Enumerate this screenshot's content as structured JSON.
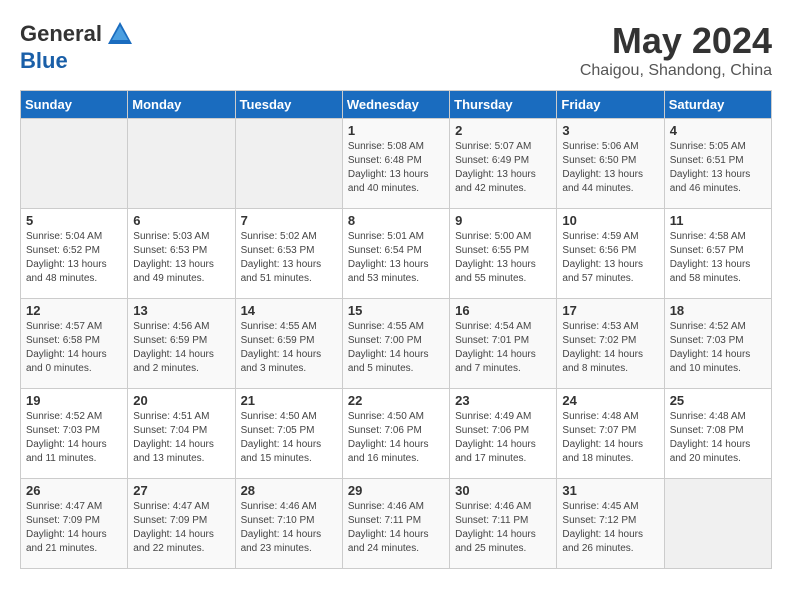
{
  "header": {
    "logo_general": "General",
    "logo_blue": "Blue",
    "month": "May 2024",
    "location": "Chaigou, Shandong, China"
  },
  "days_of_week": [
    "Sunday",
    "Monday",
    "Tuesday",
    "Wednesday",
    "Thursday",
    "Friday",
    "Saturday"
  ],
  "weeks": [
    [
      {
        "day": "",
        "info": ""
      },
      {
        "day": "",
        "info": ""
      },
      {
        "day": "",
        "info": ""
      },
      {
        "day": "1",
        "info": "Sunrise: 5:08 AM\nSunset: 6:48 PM\nDaylight: 13 hours\nand 40 minutes."
      },
      {
        "day": "2",
        "info": "Sunrise: 5:07 AM\nSunset: 6:49 PM\nDaylight: 13 hours\nand 42 minutes."
      },
      {
        "day": "3",
        "info": "Sunrise: 5:06 AM\nSunset: 6:50 PM\nDaylight: 13 hours\nand 44 minutes."
      },
      {
        "day": "4",
        "info": "Sunrise: 5:05 AM\nSunset: 6:51 PM\nDaylight: 13 hours\nand 46 minutes."
      }
    ],
    [
      {
        "day": "5",
        "info": "Sunrise: 5:04 AM\nSunset: 6:52 PM\nDaylight: 13 hours\nand 48 minutes."
      },
      {
        "day": "6",
        "info": "Sunrise: 5:03 AM\nSunset: 6:53 PM\nDaylight: 13 hours\nand 49 minutes."
      },
      {
        "day": "7",
        "info": "Sunrise: 5:02 AM\nSunset: 6:53 PM\nDaylight: 13 hours\nand 51 minutes."
      },
      {
        "day": "8",
        "info": "Sunrise: 5:01 AM\nSunset: 6:54 PM\nDaylight: 13 hours\nand 53 minutes."
      },
      {
        "day": "9",
        "info": "Sunrise: 5:00 AM\nSunset: 6:55 PM\nDaylight: 13 hours\nand 55 minutes."
      },
      {
        "day": "10",
        "info": "Sunrise: 4:59 AM\nSunset: 6:56 PM\nDaylight: 13 hours\nand 57 minutes."
      },
      {
        "day": "11",
        "info": "Sunrise: 4:58 AM\nSunset: 6:57 PM\nDaylight: 13 hours\nand 58 minutes."
      }
    ],
    [
      {
        "day": "12",
        "info": "Sunrise: 4:57 AM\nSunset: 6:58 PM\nDaylight: 14 hours\nand 0 minutes."
      },
      {
        "day": "13",
        "info": "Sunrise: 4:56 AM\nSunset: 6:59 PM\nDaylight: 14 hours\nand 2 minutes."
      },
      {
        "day": "14",
        "info": "Sunrise: 4:55 AM\nSunset: 6:59 PM\nDaylight: 14 hours\nand 3 minutes."
      },
      {
        "day": "15",
        "info": "Sunrise: 4:55 AM\nSunset: 7:00 PM\nDaylight: 14 hours\nand 5 minutes."
      },
      {
        "day": "16",
        "info": "Sunrise: 4:54 AM\nSunset: 7:01 PM\nDaylight: 14 hours\nand 7 minutes."
      },
      {
        "day": "17",
        "info": "Sunrise: 4:53 AM\nSunset: 7:02 PM\nDaylight: 14 hours\nand 8 minutes."
      },
      {
        "day": "18",
        "info": "Sunrise: 4:52 AM\nSunset: 7:03 PM\nDaylight: 14 hours\nand 10 minutes."
      }
    ],
    [
      {
        "day": "19",
        "info": "Sunrise: 4:52 AM\nSunset: 7:03 PM\nDaylight: 14 hours\nand 11 minutes."
      },
      {
        "day": "20",
        "info": "Sunrise: 4:51 AM\nSunset: 7:04 PM\nDaylight: 14 hours\nand 13 minutes."
      },
      {
        "day": "21",
        "info": "Sunrise: 4:50 AM\nSunset: 7:05 PM\nDaylight: 14 hours\nand 15 minutes."
      },
      {
        "day": "22",
        "info": "Sunrise: 4:50 AM\nSunset: 7:06 PM\nDaylight: 14 hours\nand 16 minutes."
      },
      {
        "day": "23",
        "info": "Sunrise: 4:49 AM\nSunset: 7:06 PM\nDaylight: 14 hours\nand 17 minutes."
      },
      {
        "day": "24",
        "info": "Sunrise: 4:48 AM\nSunset: 7:07 PM\nDaylight: 14 hours\nand 18 minutes."
      },
      {
        "day": "25",
        "info": "Sunrise: 4:48 AM\nSunset: 7:08 PM\nDaylight: 14 hours\nand 20 minutes."
      }
    ],
    [
      {
        "day": "26",
        "info": "Sunrise: 4:47 AM\nSunset: 7:09 PM\nDaylight: 14 hours\nand 21 minutes."
      },
      {
        "day": "27",
        "info": "Sunrise: 4:47 AM\nSunset: 7:09 PM\nDaylight: 14 hours\nand 22 minutes."
      },
      {
        "day": "28",
        "info": "Sunrise: 4:46 AM\nSunset: 7:10 PM\nDaylight: 14 hours\nand 23 minutes."
      },
      {
        "day": "29",
        "info": "Sunrise: 4:46 AM\nSunset: 7:11 PM\nDaylight: 14 hours\nand 24 minutes."
      },
      {
        "day": "30",
        "info": "Sunrise: 4:46 AM\nSunset: 7:11 PM\nDaylight: 14 hours\nand 25 minutes."
      },
      {
        "day": "31",
        "info": "Sunrise: 4:45 AM\nSunset: 7:12 PM\nDaylight: 14 hours\nand 26 minutes."
      },
      {
        "day": "",
        "info": ""
      }
    ]
  ]
}
